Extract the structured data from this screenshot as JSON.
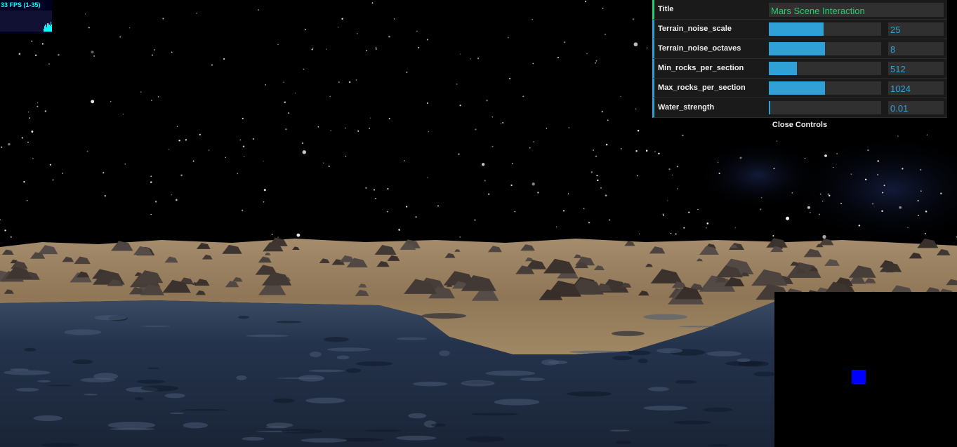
{
  "stats": {
    "fps_label": "33 FPS (1-35)",
    "fps_history": [
      0.2,
      0.4,
      0.5,
      0.5,
      0.3,
      0.6,
      0.5,
      0.6,
      0.5,
      0.4,
      0.7,
      0.5
    ]
  },
  "gui": {
    "title": {
      "label": "Title",
      "value": "Mars Scene Interaction"
    },
    "controllers": [
      {
        "label": "Terrain_noise_scale",
        "value": "25",
        "fill": 0.49
      },
      {
        "label": "Terrain_noise_octaves",
        "value": "8",
        "fill": 0.5
      },
      {
        "label": "Min_rocks_per_section",
        "value": "512",
        "fill": 0.25
      },
      {
        "label": "Max_rocks_per_section",
        "value": "1024",
        "fill": 0.5
      },
      {
        "label": "Water_strength",
        "value": "0.01",
        "fill": 0.01
      }
    ],
    "close_label": "Close Controls"
  },
  "colors": {
    "slider_accent": "#2fa1d6",
    "string_accent": "#1ed36f",
    "minimap_marker": "#0000ff",
    "fps_text": "#00ffff"
  },
  "minimap": {
    "marker": "player-position-marker"
  }
}
